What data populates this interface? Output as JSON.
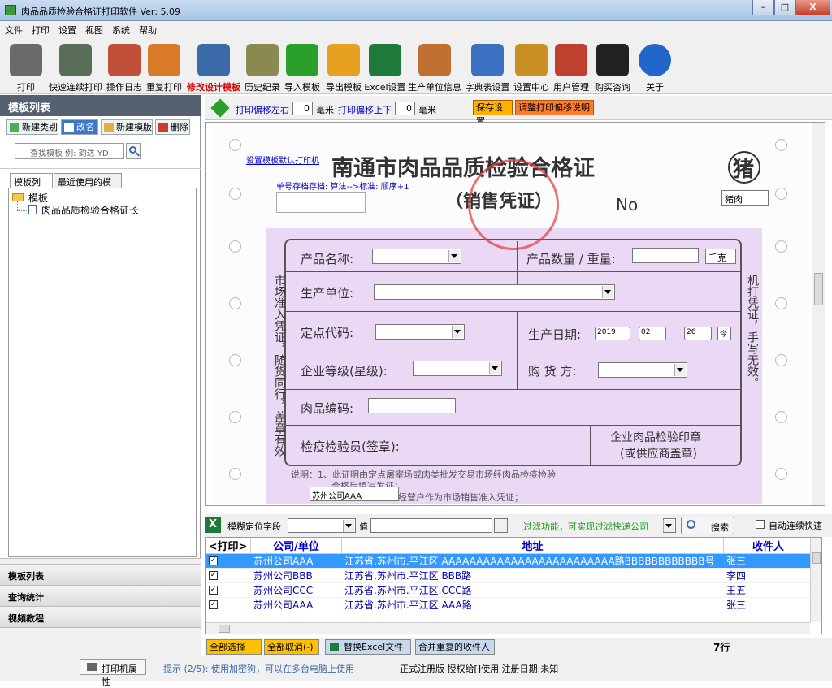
{
  "window": {
    "title": "肉品品质检验合格证打印软件 Ver: 5.09",
    "min": "–",
    "max": "□",
    "close": "X"
  },
  "menu": [
    "文件",
    "打印",
    "设置",
    "视图",
    "系统",
    "帮助"
  ],
  "toolbar": [
    {
      "label": "打印",
      "icon": "printer-icon",
      "color": "#6a6a6a"
    },
    {
      "label": "快速连续打印",
      "icon": "fast-print-icon",
      "color": "#5a6e5a"
    },
    {
      "label": "操作日志",
      "icon": "log-user-icon",
      "color": "#c0503a"
    },
    {
      "label": "重复打印",
      "icon": "reprint-icon",
      "color": "#d87a2a"
    },
    {
      "label": "修改设计模板",
      "icon": "design-icon",
      "color": "#3a6aa8",
      "highlight": "#e00000"
    },
    {
      "label": "历史纪录",
      "icon": "history-icon",
      "color": "#8a8a50"
    },
    {
      "label": "导入模板",
      "icon": "import-arrow-icon",
      "color": "#2aa02a"
    },
    {
      "label": "导出模板",
      "icon": "export-arrow-icon",
      "color": "#e8a020"
    },
    {
      "label": "Excel设置",
      "icon": "excel-icon",
      "color": "#1d7a3a"
    },
    {
      "label": "生产单位信息",
      "icon": "company-users-icon",
      "color": "#c07030"
    },
    {
      "label": "字典表设置",
      "icon": "dictionary-icon",
      "color": "#3a70c0"
    },
    {
      "label": "设置中心",
      "icon": "tools-icon",
      "color": "#c89020"
    },
    {
      "label": "用户管理",
      "icon": "user-manage-icon",
      "color": "#c04030"
    },
    {
      "label": "购买咨询",
      "icon": "qq-icon",
      "color": "#222222"
    },
    {
      "label": "关于",
      "icon": "info-icon",
      "color": "#2266cc"
    }
  ],
  "left": {
    "header": "模板列表",
    "buttons": [
      "新建类别",
      "改名",
      "新建模版",
      "删除"
    ],
    "search_placeholder": "查找模板 例: 韵达 YD",
    "tabs": [
      "模板列表",
      "最近使用的模板"
    ],
    "tree": {
      "folder": "模板",
      "item": "肉品品质检验合格证长"
    },
    "nav": [
      "模板列表",
      "查询统计",
      "视频教程"
    ]
  },
  "offset": {
    "lr_label": "打印偏移左右",
    "lr_value": "0",
    "lr_unit": "毫米",
    "ud_label": "打印偏移上下",
    "ud_value": "0",
    "ud_unit": "毫米",
    "save": "保存设置",
    "help": "调整打印偏移说明"
  },
  "cert": {
    "default_link": "设置模板默认打印机",
    "title": "南通市肉品品质检验合格证",
    "animal": "猪",
    "subtitle": "（销售凭证）",
    "no": "No",
    "seq_note": "单号存档存档: 算法-->标准: 顺序+1",
    "meat_value": "猪肉",
    "product_name": "产品名称:",
    "product_qty": "产品数量 / 重量:",
    "unit": "千克",
    "producer": "生产单位:",
    "fixed_code": "定点代码:",
    "prod_date": "生产日期:",
    "year": "2019",
    "month": "02",
    "day": "26",
    "today": "今",
    "grade": "企业等级(星级):",
    "buyer": "购  货  方:",
    "meat_code": "肉品编码:",
    "inspector": "检疫检验员(签章):",
    "stamp_line1": "企业肉品检验印章",
    "stamp_line2": "(或供应商盖章)",
    "left_vertical": "市场准入凭证，随货同行，盖章有效",
    "right_vertical": "机打凭证，手写无效。",
    "note_line1": "说明：1、此证明由定点屠宰场或肉类批发交易市场经肉品检疫检验",
    "note_line2": "合格后填写发证；",
    "note_line3": "经营户作为市场销售准入凭证；",
    "company_value": "苏州公司AAA"
  },
  "filter": {
    "label": "模糊定位字段",
    "value_label": "值",
    "hint": "过滤功能，可实现过滤快递公司",
    "search": "搜索",
    "auto": "自动连续快速"
  },
  "grid": {
    "headers": [
      "<打印>",
      "公司/单位",
      "地址",
      "收件人"
    ],
    "rows": [
      {
        "company": "苏州公司AAA",
        "address": "江苏省.苏州市.平江区.AAAAAAAAAAAAAAAAAAAAAAAAA路BBBBBBBBBBBB号",
        "recipient": "张三",
        "selected": true
      },
      {
        "company": "苏州公司BBB",
        "address": "江苏省.苏州市.平江区.BBB路",
        "recipient": "李四",
        "selected": false
      },
      {
        "company": "苏州公司CCC",
        "address": "江苏省.苏州市.平江区.CCC路",
        "recipient": "王五",
        "selected": false
      },
      {
        "company": "苏州公司AAA",
        "address": "江苏省.苏州市.平江区.AAA路",
        "recipient": "张三",
        "selected": false
      }
    ]
  },
  "bottom": {
    "select_all": "全部选择(+)",
    "unselect_all": "全部取消(-)",
    "excel": "替换Excel文件",
    "merge": "合并重复的收件人",
    "count": "7行"
  },
  "status": {
    "printer": "打印机属性",
    "tip": "提示 (2/5): 使用加密狗，可以在多台电脑上使用",
    "reg": "正式注册版 授权给[]使用 注册日期:未知"
  }
}
